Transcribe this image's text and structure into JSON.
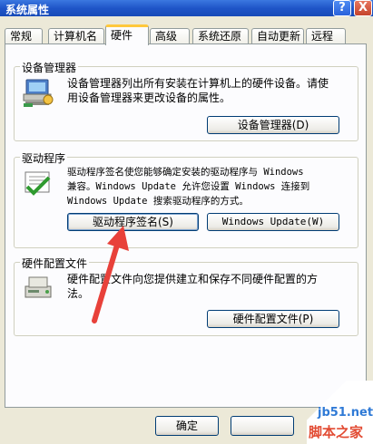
{
  "window": {
    "title": "系统属性",
    "help_button": "?",
    "close_button": "X"
  },
  "tabs": [
    {
      "label": "常规"
    },
    {
      "label": "计算机名"
    },
    {
      "label": "硬件",
      "active": true
    },
    {
      "label": "高级"
    },
    {
      "label": "系统还原"
    },
    {
      "label": "自动更新"
    },
    {
      "label": "远程"
    }
  ],
  "device_manager": {
    "title": "设备管理器",
    "description_line1": "设备管理器列出所有安装在计算机上的硬件设备。请使",
    "description_line2": "用设备管理器来更改设备的属性。",
    "button": "设备管理器(D)",
    "icon": "device-manager-icon"
  },
  "drivers": {
    "title": "驱动程序",
    "description_line1": "驱动程序签名使您能够确定安装的驱动程序与 Windows",
    "description_line2": "兼容。Windows Update 允许您设置 Windows 连接到",
    "description_line3": "Windows Update 搜索驱动程序的方式。",
    "signing_button": "驱动程序签名(S)",
    "update_button": "Windows Update(W)",
    "icon": "driver-signing-icon"
  },
  "hardware_profiles": {
    "title": "硬件配置文件",
    "description_line1": "硬件配置文件向您提供建立和保存不同硬件配置的方",
    "description_line2": "法。",
    "button": "硬件配置文件(P)",
    "icon": "hardware-profile-icon"
  },
  "footer": {
    "ok_button": "确定"
  },
  "watermark": {
    "site": "jb51.net",
    "brand": "脚本之家"
  },
  "colors": {
    "titlebar": "#1f55c8",
    "arrow": "#e8413a",
    "face": "#ece9d8"
  }
}
